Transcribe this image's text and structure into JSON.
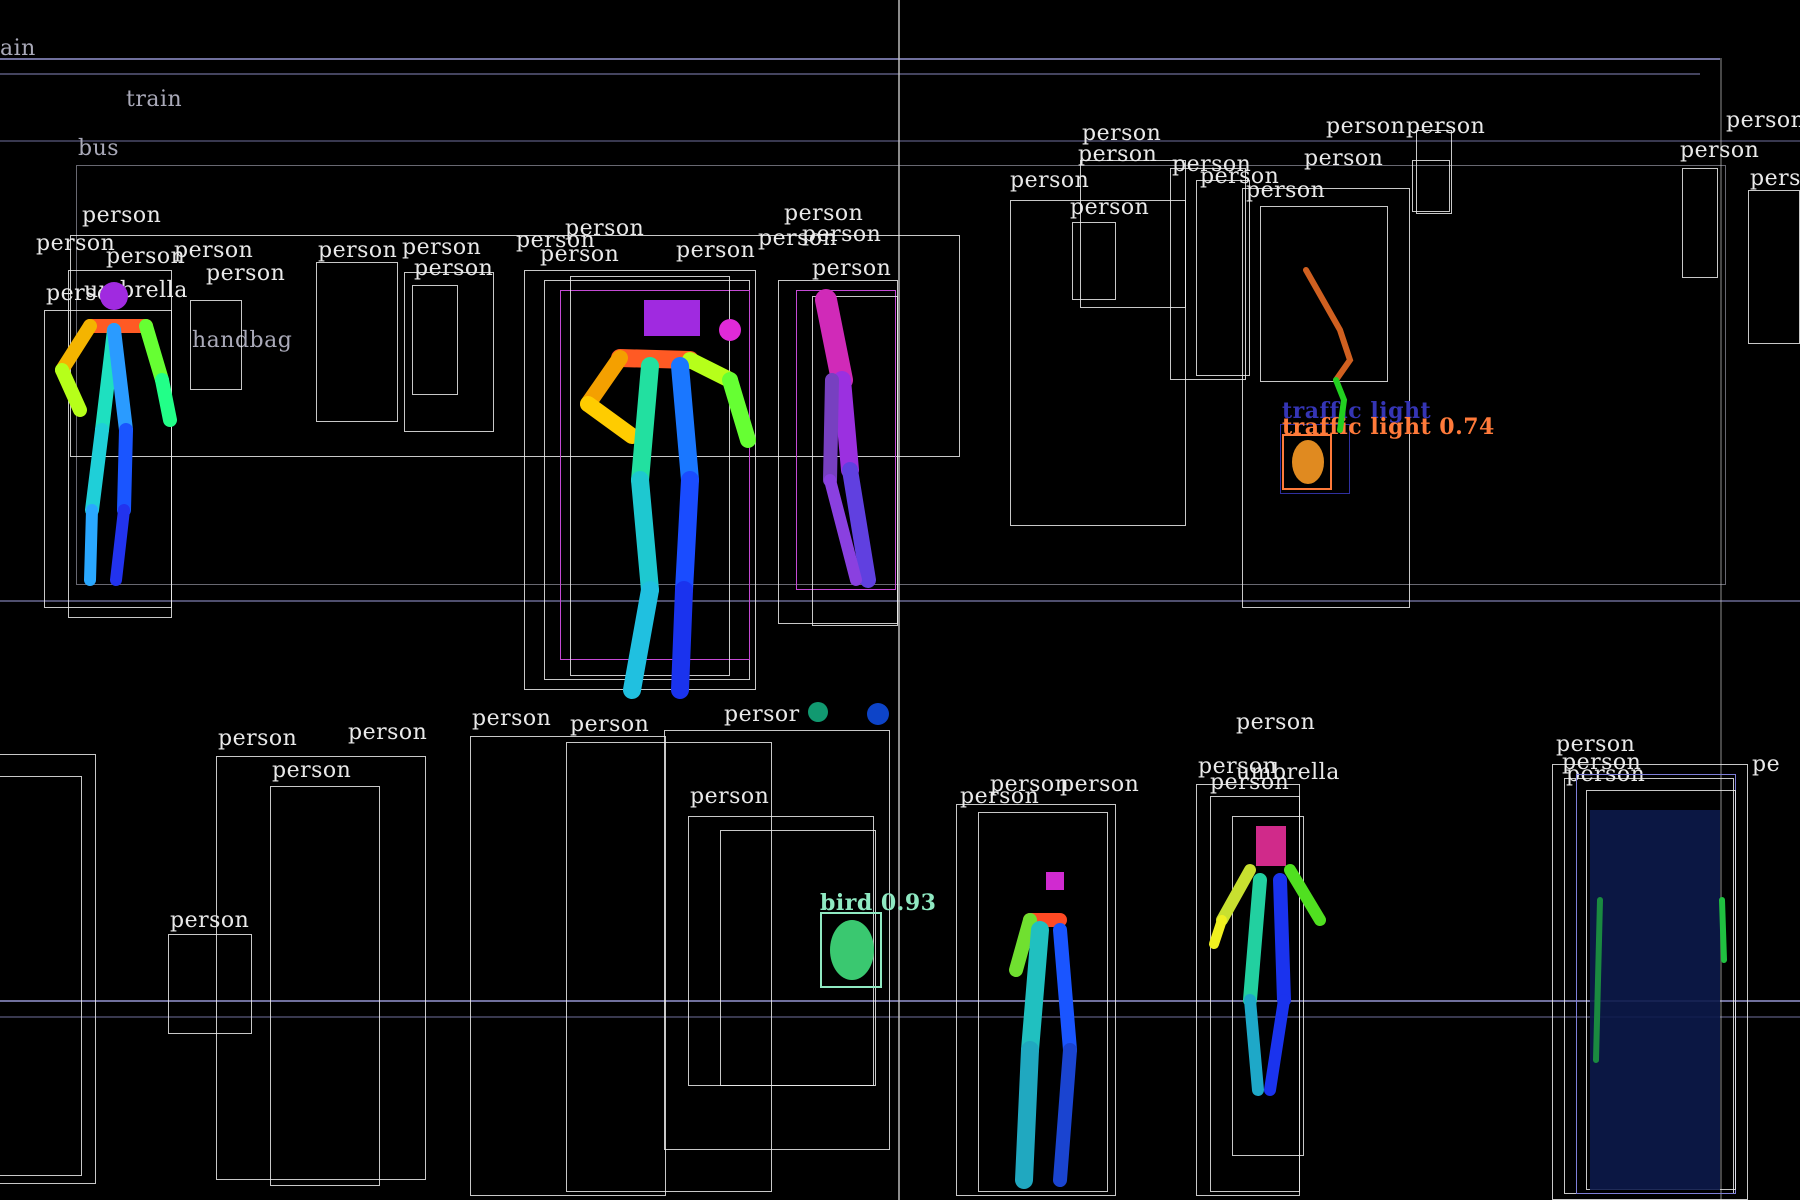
{
  "labels": {
    "train_partial": "ain",
    "train": "train",
    "bus": "bus",
    "person": "person",
    "umbrella": "umbrella",
    "handbag": "handbag",
    "traffic_light": "traffic light",
    "traffic_light_score": "traffic light 0.74",
    "bird_score": "bird 0.93",
    "person_cut": "persor",
    "pe": "pe"
  },
  "colors": {
    "background": "#000000",
    "box": "#ebebeb",
    "traffic_light": "#ff7a3a",
    "bird": "#8fe9c2",
    "magenta": "#c44ad4"
  }
}
